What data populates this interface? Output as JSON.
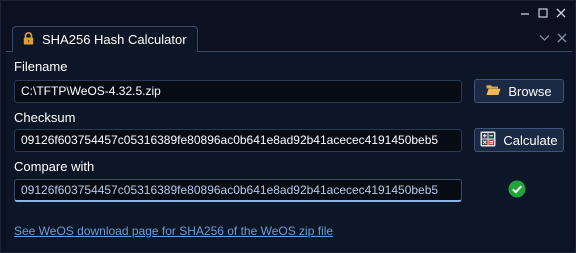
{
  "window": {
    "controls": {
      "minimize_icon": "minimize-icon",
      "maximize_icon": "maximize-icon",
      "close_icon": "close-icon"
    }
  },
  "tab": {
    "title": "SHA256 Hash Calculator",
    "icon": "lock-icon",
    "controls": {
      "collapse_icon": "chevron-down-icon",
      "close_icon": "close-icon"
    }
  },
  "filename": {
    "label": "Filename",
    "value": "C:\\TFTP\\WeOS-4.32.5.zip",
    "button_label": "Browse",
    "button_icon": "folder-open-icon"
  },
  "checksum": {
    "label": "Checksum",
    "value": "09126f603754457c05316389fe80896ac0b641e8ad92b41acecec4191450beb5",
    "button_label": "Calculate",
    "button_icon": "calculator-icon"
  },
  "compare": {
    "label": "Compare with",
    "value": "09126f603754457c05316389fe80896ac0b641e8ad92b41acecec4191450beb5",
    "status_icon": "check-circle-icon"
  },
  "link": {
    "text": "See WeOS download page for SHA256 of the WeOS zip file"
  },
  "colors": {
    "background": "#0b1120",
    "panel": "#0d1626",
    "button": "#1a2a44",
    "link": "#6f9ad6",
    "success": "#22a33a",
    "lock": "#e0a030",
    "folder": "#e8a640"
  }
}
